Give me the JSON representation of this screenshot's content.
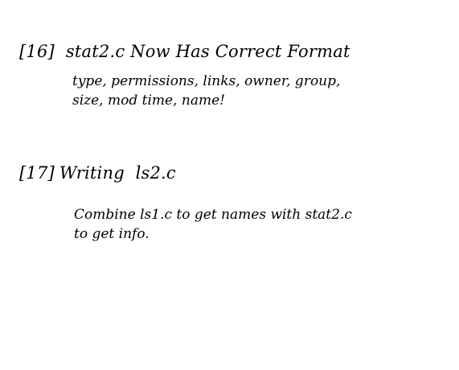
{
  "slides": [
    {
      "number": "[16]",
      "title": "stat2.c Now Has Correct Format",
      "lines": [
        "type, permissions, links, owner, group,",
        "size, mod time, name!"
      ]
    },
    {
      "number": "[17]",
      "title": "Writing  ls2.c",
      "lines": [
        "Combine ls1.c to get names with stat2.c",
        "to get info."
      ]
    }
  ]
}
